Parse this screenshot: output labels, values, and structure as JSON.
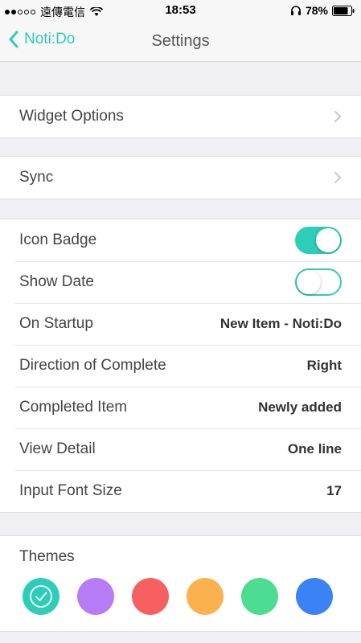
{
  "status_bar": {
    "carrier": "遠傳電信",
    "time": "18:53",
    "battery": "78%",
    "signal_strength": 2,
    "signal_max": 5
  },
  "nav": {
    "back_label": "Noti:Do",
    "title": "Settings"
  },
  "sections": {
    "widget": {
      "label": "Widget Options"
    },
    "sync": {
      "label": "Sync"
    },
    "options": {
      "icon_badge": {
        "label": "Icon Badge",
        "on": true
      },
      "show_date": {
        "label": "Show Date",
        "on": false
      },
      "on_startup": {
        "label": "On Startup",
        "value": "New Item - Noti:Do"
      },
      "direction": {
        "label": "Direction of Complete",
        "value": "Right"
      },
      "completed_item": {
        "label": "Completed Item",
        "value": "Newly added"
      },
      "view_detail": {
        "label": "View Detail",
        "value": "One line"
      },
      "font_size": {
        "label": "Input Font Size",
        "value": "17"
      }
    },
    "themes": {
      "label": "Themes",
      "swatches": [
        {
          "name": "teal",
          "color": "#2dcdb8",
          "selected": true
        },
        {
          "name": "purple",
          "color": "#b57cf6",
          "selected": false
        },
        {
          "name": "red",
          "color": "#f76060",
          "selected": false
        },
        {
          "name": "orange",
          "color": "#fbb14d",
          "selected": false
        },
        {
          "name": "green",
          "color": "#4cdc92",
          "selected": false
        },
        {
          "name": "blue",
          "color": "#3b82f6",
          "selected": false
        }
      ]
    }
  },
  "colors": {
    "accent": "#2dcdb8",
    "background": "#efeff4"
  }
}
